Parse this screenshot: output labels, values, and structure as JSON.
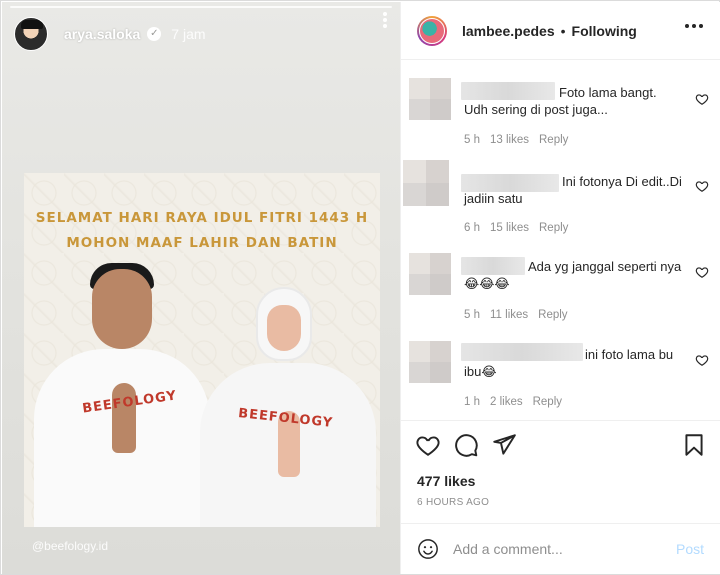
{
  "story": {
    "username": "arya.saloka",
    "verified_icon": "verified-check-icon",
    "time": "7 jam",
    "poster": {
      "line1": "SELAMAT HARI RAYA IDUL FITRI 1443 H",
      "line2": "MOHON MAAF LAHIR DAN BATIN",
      "brand_left": "BEEFOLOGY",
      "brand_right": "BEEFOLOGY"
    },
    "watermark": "@beefology.id"
  },
  "post": {
    "username": "lambee.pedes",
    "separator": "•",
    "follow_status": "Following",
    "comments": [
      {
        "text": "Foto lama bangt. Udh sering di post juga...",
        "time": "5 h",
        "likes": "13 likes",
        "reply": "Reply"
      },
      {
        "text": "Ini fotonya Di edit..Di jadiin satu",
        "time": "6 h",
        "likes": "15 likes",
        "reply": "Reply"
      },
      {
        "text": "Ada yg janggal seperti nya😂😂😂",
        "time": "5 h",
        "likes": "11 likes",
        "reply": "Reply"
      },
      {
        "text": "ini foto lama bu ibu😂",
        "time": "1 h",
        "likes": "2 likes",
        "reply": "Reply"
      }
    ],
    "likes_total": "477 likes",
    "time_ago": "6 HOURS AGO",
    "comment_placeholder": "Add a comment...",
    "post_label": "Post"
  },
  "icons": {
    "like": "heart-icon",
    "comment": "comment-bubble-icon",
    "share": "paper-plane-icon",
    "save": "bookmark-icon",
    "emoji": "smiley-face-icon",
    "more": "more-horizontal-icon"
  },
  "colors": {
    "poster_text": "#c9973a",
    "post_button": "#b3dbff",
    "muted_text": "#8e8e8e"
  }
}
